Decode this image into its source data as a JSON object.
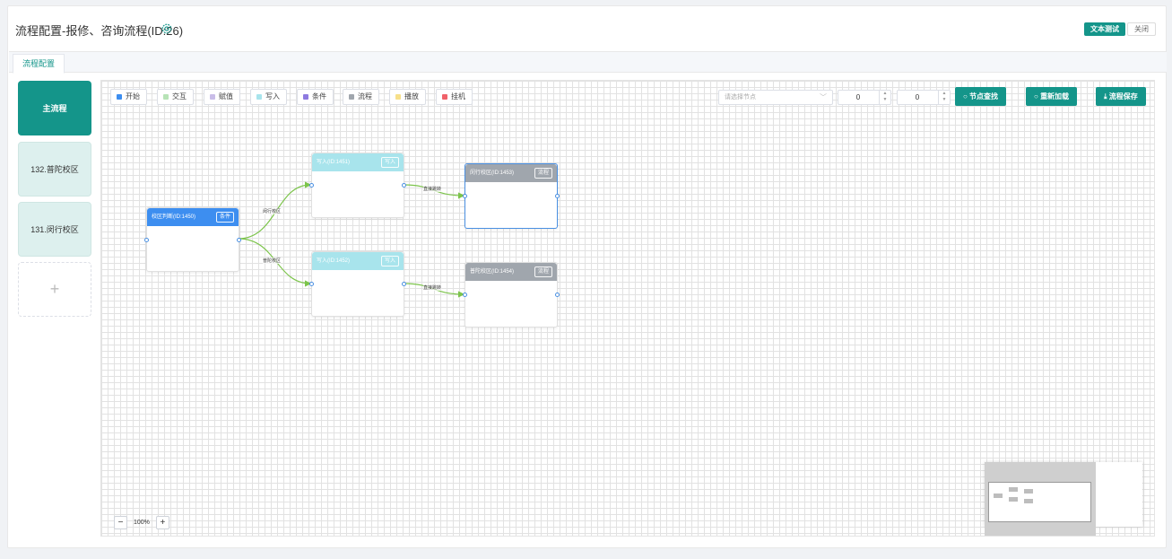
{
  "header": {
    "title": "流程配置-报修、咨询流程(ID:26)",
    "test_label": "文本测试",
    "close_label": "关闭"
  },
  "tabs": [
    {
      "label": "流程配置"
    }
  ],
  "sidebar": {
    "items": [
      {
        "label": "主流程"
      },
      {
        "label": "132.普陀校区"
      },
      {
        "label": "131.闵行校区"
      }
    ],
    "add_label": "+"
  },
  "legend": [
    {
      "label": "开始",
      "color": "#3d8ef0"
    },
    {
      "label": "交互",
      "color": "#b7e3b6"
    },
    {
      "label": "赋值",
      "color": "#c9bde8"
    },
    {
      "label": "写入",
      "color": "#a8e4ec"
    },
    {
      "label": "条件",
      "color": "#8e7ae0"
    },
    {
      "label": "流程",
      "color": "#a0a6ad"
    },
    {
      "label": "播放",
      "color": "#f7e08a"
    },
    {
      "label": "挂机",
      "color": "#f0626a"
    }
  ],
  "controls": {
    "node_select_placeholder": "请选择节点",
    "x_value": "0",
    "y_value": "0",
    "find_label": "节点查找",
    "reload_label": "重新加载",
    "save_label": "流程保存"
  },
  "nodes": [
    {
      "title": "校区判断(ID:1450)",
      "tag": "条件",
      "color": "#3d8ef0"
    },
    {
      "title": "写入(ID:1451)",
      "tag": "写入",
      "color": "#a8e4ec"
    },
    {
      "title": "写入(ID:1452)",
      "tag": "写入",
      "color": "#a8e4ec"
    },
    {
      "title": "闵行校区(ID:1453)",
      "tag": "流程",
      "color": "#a0a6ad"
    },
    {
      "title": "普陀校区(ID:1454)",
      "tag": "流程",
      "color": "#a0a6ad"
    }
  ],
  "edges": [
    {
      "label": "闵行校区"
    },
    {
      "label": "普陀校区"
    },
    {
      "label": "直接跳转"
    },
    {
      "label": "直接跳转"
    }
  ],
  "zoom": {
    "level": "100%",
    "minus": "−",
    "plus": "+"
  },
  "colors": {
    "accent": "#14958a",
    "edge": "#7cc44b",
    "selected": "#4a90e2"
  }
}
